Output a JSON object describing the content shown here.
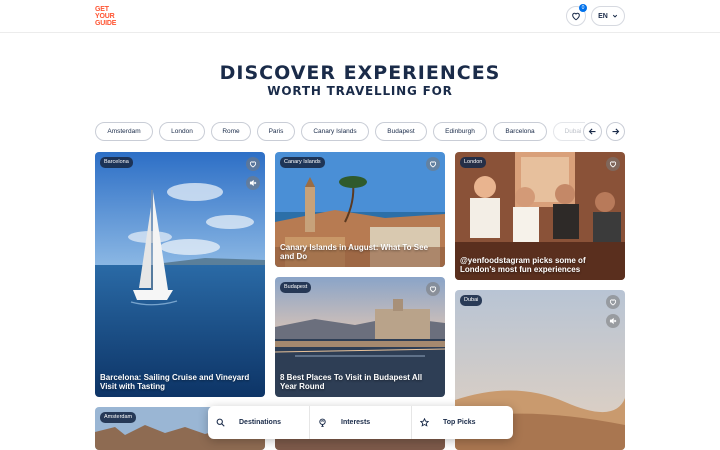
{
  "header": {
    "logo": [
      "GET",
      "YOUR",
      "GUIDE"
    ],
    "wishlist_count": "0",
    "language": "EN",
    "brand_color": "#ff5533"
  },
  "hero": {
    "title": "DISCOVER EXPERIENCES",
    "subtitle": "WORTH TRAVELLING FOR"
  },
  "destinations": [
    "Amsterdam",
    "London",
    "Rome",
    "Paris",
    "Canary Islands",
    "Budapest",
    "Edinburgh",
    "Barcelona",
    "Dubai"
  ],
  "cards": {
    "barcelona": {
      "tag": "Barcelona",
      "title": "Barcelona: Sailing Cruise and Vineyard Visit with Tasting"
    },
    "canary": {
      "tag": "Canary Islands",
      "title": "Canary Islands in August: What To See and Do"
    },
    "london": {
      "tag": "London",
      "title": "@yenfoodstagram picks some of London's most fun experiences"
    },
    "budapest": {
      "tag": "Budapest",
      "title": "8 Best Places To Visit in Budapest All Year Round"
    },
    "dubai": {
      "tag": "Dubai"
    },
    "amsterdam": {
      "tag": "Amsterdam"
    }
  },
  "bottom_nav": {
    "destinations": "Destinations",
    "interests": "Interests",
    "top_picks": "Top Picks"
  }
}
